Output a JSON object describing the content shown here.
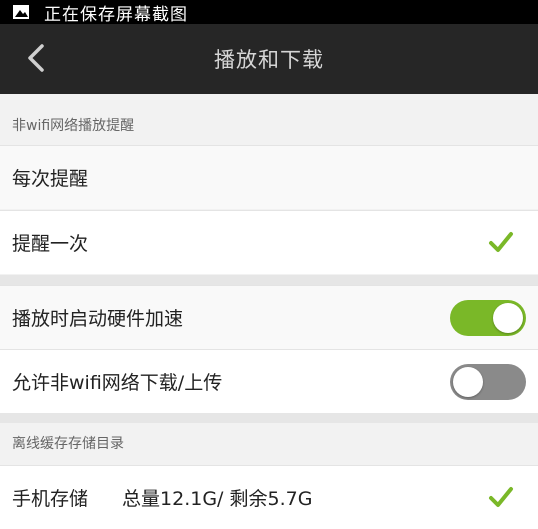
{
  "status_bar": {
    "notification_text": "正在保存屏幕截图",
    "icon": "image-icon"
  },
  "header": {
    "title": "播放和下载",
    "back_icon": "chevron-left-icon"
  },
  "section_mobile_network": {
    "title": "非wifi网络播放提醒",
    "options": [
      {
        "label": "每次提醒",
        "selected": false
      },
      {
        "label": "提醒一次",
        "selected": true
      }
    ]
  },
  "settings": {
    "hw_accel": {
      "label": "播放时启动硬件加速",
      "enabled": true
    },
    "mobile_download": {
      "label": "允许非wifi网络下载/上传",
      "enabled": false
    }
  },
  "section_storage": {
    "title": "离线缓存存储目录",
    "items": [
      {
        "label": "手机存储",
        "detail": "总量12.1G/ 剩余5.7G",
        "selected": true
      }
    ]
  },
  "colors": {
    "accent_green": "#7ab828",
    "header_bg": "#262626",
    "toggle_off": "#8a8a8a"
  }
}
